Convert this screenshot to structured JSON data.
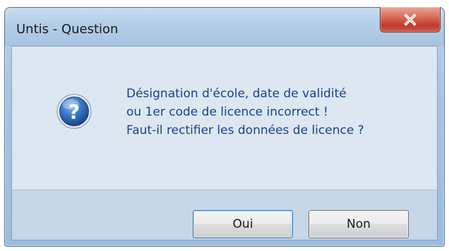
{
  "window": {
    "title": "Untis - Question"
  },
  "icons": {
    "close": "close-icon",
    "message": "question-icon"
  },
  "message": {
    "lines": [
      "Désignation d'école, date de validité",
      "ou 1er code de licence incorrect !",
      "Faut-il rectifier les données de licence ?"
    ]
  },
  "buttons": {
    "yes_label": "Oui",
    "no_label": "Non"
  },
  "colors": {
    "message_text": "#1c3f8c",
    "close_button": "#c1392b",
    "question_icon": "#2f6db8"
  }
}
